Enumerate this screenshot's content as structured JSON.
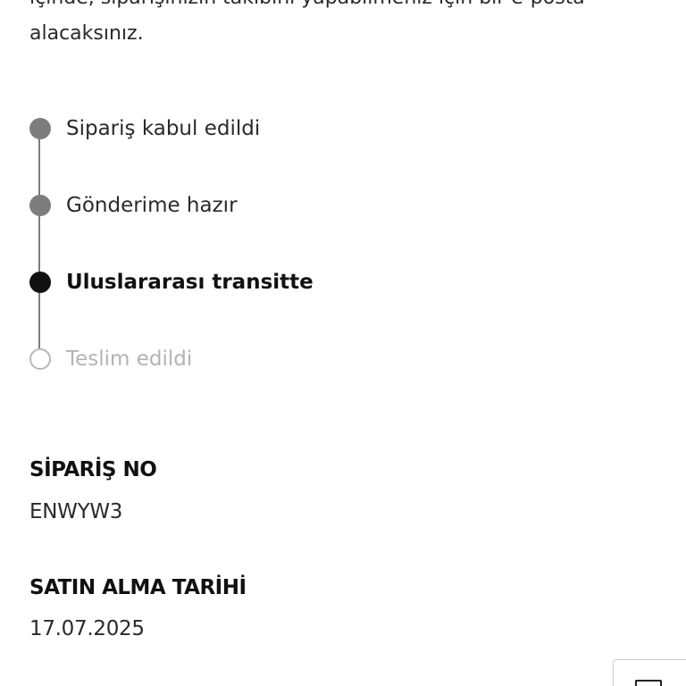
{
  "intro": {
    "line1": "içinde, siparişinizin takibini yapabilmeniz için bir e-posta",
    "line2": "alacaksınız."
  },
  "timeline": {
    "steps": [
      {
        "label": "Sipariş kabul edildi",
        "state": "done"
      },
      {
        "label": "Gönderime hazır",
        "state": "done"
      },
      {
        "label": "Uluslararası transitte",
        "state": "current"
      },
      {
        "label": "Teslim edildi",
        "state": "pending"
      }
    ]
  },
  "order": {
    "number_title": "SİPARİŞ NO",
    "number_value": "ENWYW3",
    "date_title": "SATIN ALMA TARİHİ",
    "date_value": "17.07.2025"
  },
  "colors": {
    "done": "#7d7d7d",
    "current": "#111111",
    "pending": "#b8b8b8"
  }
}
